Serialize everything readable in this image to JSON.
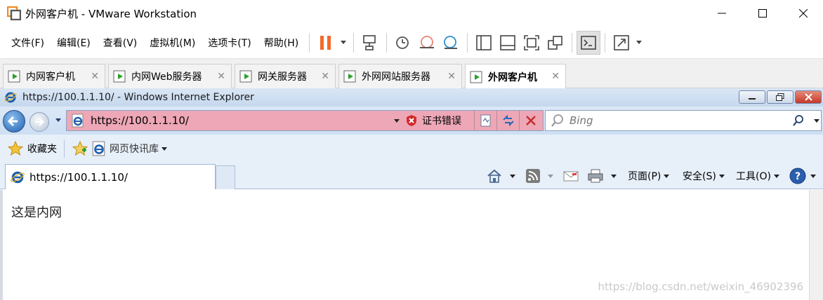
{
  "window": {
    "title": "外网客户机 - VMware Workstation"
  },
  "menu": {
    "items": [
      "文件(F)",
      "编辑(E)",
      "查看(V)",
      "虚拟机(M)",
      "选项卡(T)",
      "帮助(H)"
    ]
  },
  "vm_tabs": [
    {
      "label": "内网客户机"
    },
    {
      "label": "内网Web服务器"
    },
    {
      "label": "网关服务器"
    },
    {
      "label": "外网网站服务器"
    },
    {
      "label": "外网客户机",
      "active": true
    }
  ],
  "ie": {
    "title": "https://100.1.1.10/ - Windows Internet Explorer",
    "address": "https://100.1.1.10/",
    "cert_error": "证书错误",
    "search_placeholder": "Bing",
    "favorites_label": "收藏夹",
    "web_slice_label": "网页快讯库",
    "tab_title": "https://100.1.1.10/",
    "commands": {
      "page": "页面(P)",
      "safety": "安全(S)",
      "tools": "工具(O)"
    }
  },
  "page": {
    "content": "这是内网"
  },
  "watermark": "https://blog.csdn.net/weixin_46902396",
  "colors": {
    "address_error_bg": "#eda7b6",
    "pause_orange": "#f36a2a",
    "ie_blue": "#1f5fae"
  }
}
